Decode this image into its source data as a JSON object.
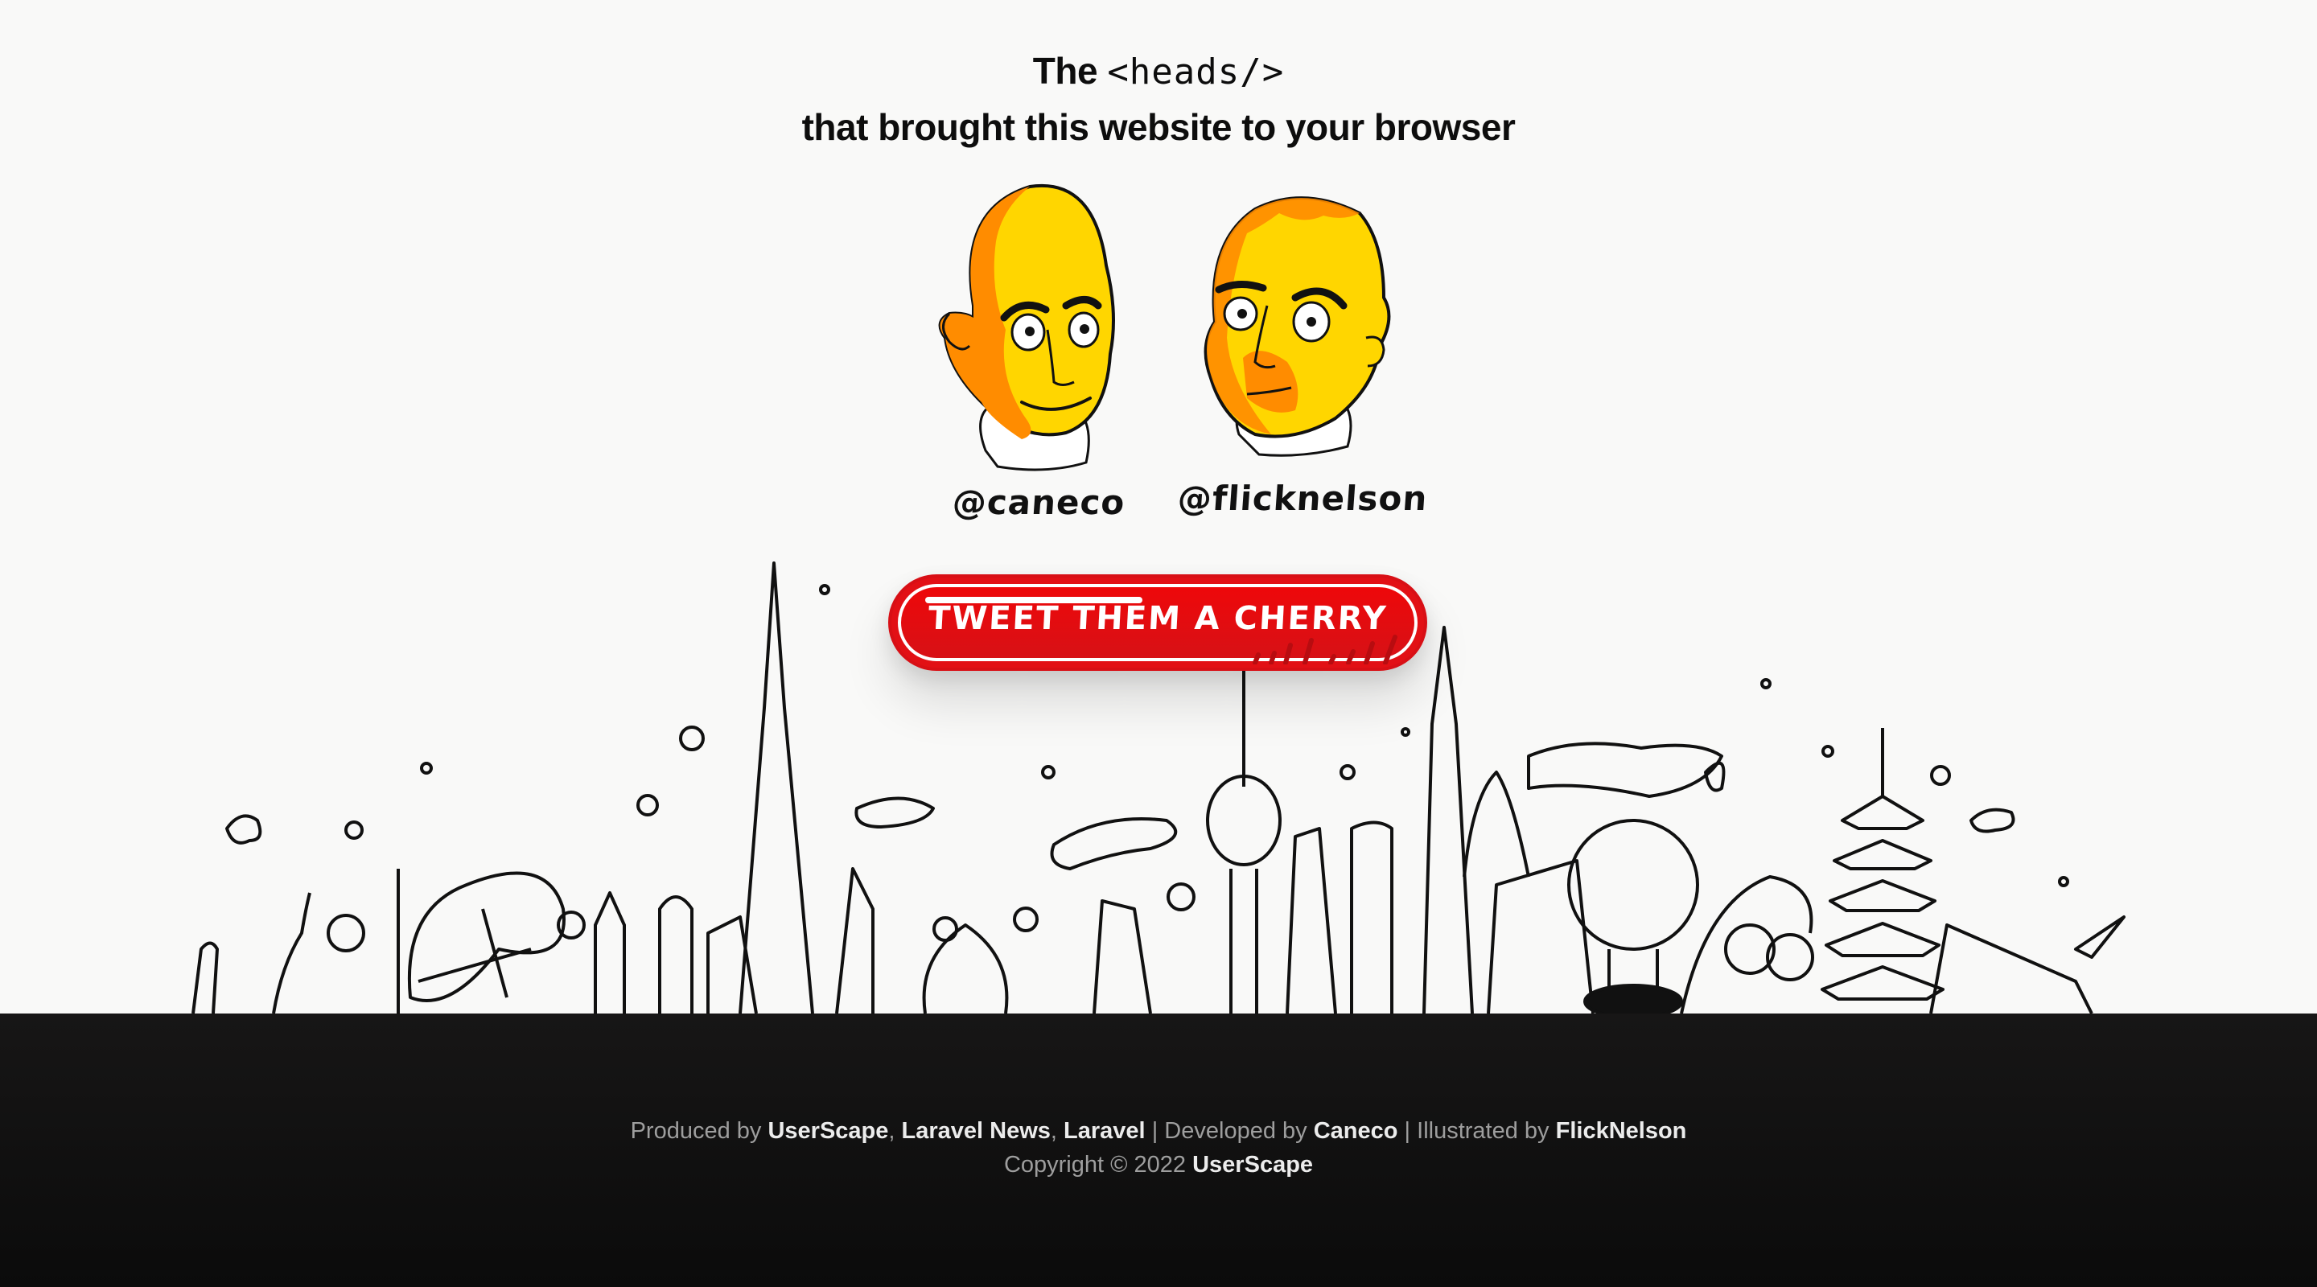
{
  "header": {
    "title_prefix": "The",
    "title_code": "<heads/>",
    "subtitle": "that brought this website to your browser"
  },
  "people": [
    {
      "handle": "@caneco",
      "avatar": "caneco-caricature-illustration"
    },
    {
      "handle": "@flicknelson",
      "avatar": "flicknelson-caricature-illustration"
    }
  ],
  "cta": {
    "label": "TWEET THEM A CHERRY",
    "color": "#e21015"
  },
  "illustration": {
    "subject": "doodle-city-skyline"
  },
  "footer": {
    "produced_by_label": "Produced by",
    "producers": [
      "UserScape",
      "Laravel News",
      "Laravel"
    ],
    "separator": "|",
    "developed_by_label": "Developed by",
    "developer": "Caneco",
    "illustrated_by_label": "Illustrated by",
    "illustrator": "FlickNelson",
    "copyright_label": "Copyright © 2022",
    "copyright_holder": "UserScape"
  },
  "colors": {
    "background": "#f9f9f8",
    "footer_bg": "#121212",
    "skin_yellow": "#ffd600",
    "skin_orange": "#ff8c00"
  }
}
